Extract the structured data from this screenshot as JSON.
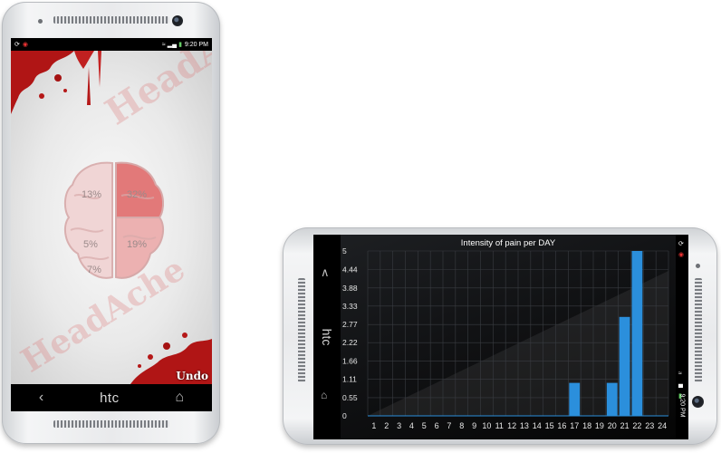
{
  "portrait": {
    "status_time": "9:20 PM",
    "watermark": "HeadAche",
    "watermark_top": "HeadA",
    "regions": [
      {
        "label": "13%",
        "pos": "front-left"
      },
      {
        "label": "32%",
        "pos": "front-right"
      },
      {
        "label": "5%",
        "pos": "mid-left"
      },
      {
        "label": "19%",
        "pos": "mid-right"
      },
      {
        "label": "7%",
        "pos": "back-left"
      }
    ],
    "undo_label": "Undo",
    "nav": {
      "back": "‹",
      "brand": "htc",
      "home": "⌂"
    }
  },
  "landscape": {
    "status_time": "9:20 PM",
    "nav": {
      "up": "∧",
      "brand": "htc",
      "home": "⌂"
    }
  },
  "chart_data": {
    "type": "bar",
    "title": "Intensity of pain per DAY",
    "categories": [
      "1",
      "2",
      "3",
      "4",
      "5",
      "6",
      "7",
      "8",
      "9",
      "10",
      "11",
      "12",
      "13",
      "14",
      "15",
      "16",
      "17",
      "18",
      "19",
      "20",
      "21",
      "22",
      "23",
      "24"
    ],
    "values": [
      0,
      0,
      0,
      0,
      0,
      0,
      0,
      0,
      0,
      0,
      0,
      0,
      0,
      0,
      0,
      0,
      1,
      0,
      0,
      1,
      3,
      5,
      0,
      0
    ],
    "yticks": [
      "0",
      "0.55",
      "1.11",
      "1.66",
      "2.22",
      "2.77",
      "3.33",
      "3.88",
      "4.44",
      "5"
    ],
    "ylim": [
      0,
      5
    ],
    "bar_color": "#2b8fdc",
    "grid": true,
    "xlabel": "",
    "ylabel": ""
  }
}
